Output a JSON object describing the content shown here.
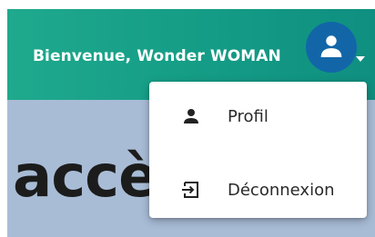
{
  "header": {
    "welcome_text": "Bienvenue, Wonder WOMAN",
    "avatar_icon": "user-icon",
    "caret_icon": "caret-down-icon"
  },
  "page": {
    "heading_fragment": "accè"
  },
  "user_menu": {
    "items": [
      {
        "label": "Profil",
        "icon": "person-icon"
      },
      {
        "label": "Déconnexion",
        "icon": "logout-icon"
      }
    ]
  },
  "colors": {
    "header_gradient_start": "#1fa98d",
    "header_gradient_end": "#0f8f80",
    "avatar_bg": "#1266a8",
    "content_bg": "#a8bcd6"
  }
}
